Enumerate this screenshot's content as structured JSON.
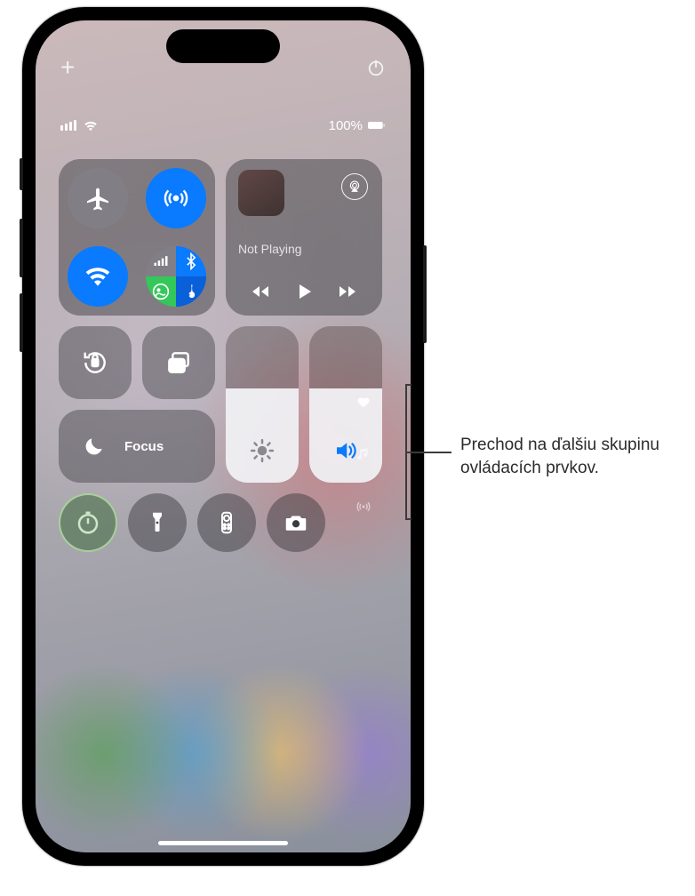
{
  "status": {
    "battery_pct": "100%"
  },
  "media": {
    "label": "Not Playing"
  },
  "focus": {
    "label": "Focus"
  },
  "brightness_pct": 60,
  "volume_pct": 60,
  "callout": "Prechod na ďalšiu skupinu ovládacích prvkov."
}
